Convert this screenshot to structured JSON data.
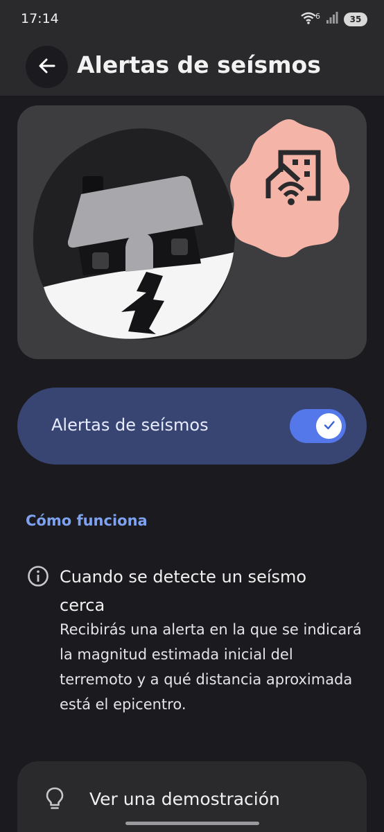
{
  "status_bar": {
    "time": "17:14",
    "battery": "35",
    "network_type_badge": "6"
  },
  "app_bar": {
    "title": "Alertas de seísmos",
    "back_icon": "arrow-back-icon"
  },
  "hero": {
    "illustration": "house-earthquake-illustration",
    "badge_icon": "building-broadcast-icon",
    "colors": {
      "badge": "#f4b4a8",
      "background": "#3d3d40"
    }
  },
  "toggle": {
    "label": "Alertas de seísmos",
    "enabled": true,
    "check_icon": "check-icon"
  },
  "how_it_works": {
    "section_title": "Cómo funciona",
    "items": [
      {
        "icon": "info-icon",
        "title": "Cuando se detecte un seísmo cerca",
        "body": "Recibirás una alerta en la que se indicará la magnitud estimada inicial del terremoto y a qué distancia aproximada está el epicentro."
      }
    ]
  },
  "demo": {
    "icon": "lightbulb-icon",
    "label": "Ver una demostración"
  },
  "colors": {
    "accent": "#5478ea",
    "link": "#7fa2f0",
    "toggle_card": "#384573"
  }
}
